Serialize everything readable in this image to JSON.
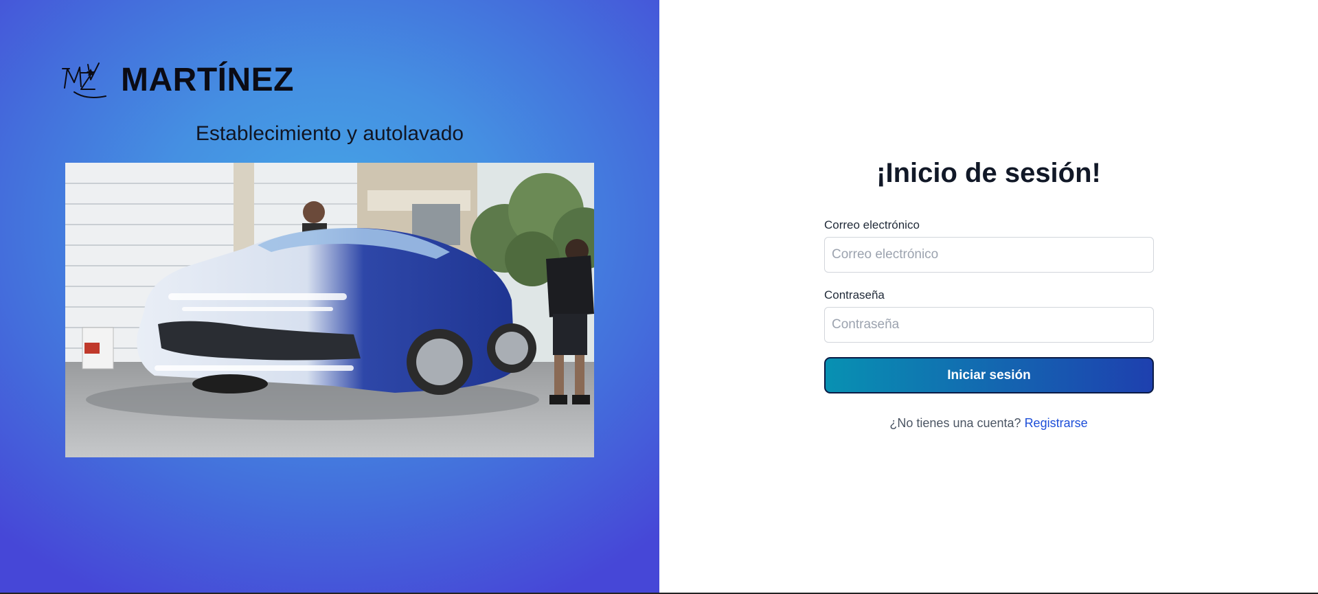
{
  "brand": {
    "name": "MARTÍNEZ",
    "tagline": "Establecimiento y autolavado"
  },
  "login": {
    "title": "¡Inicio de sesión!",
    "email": {
      "label": "Correo electrónico",
      "placeholder": "Correo electrónico",
      "value": ""
    },
    "password": {
      "label": "Contraseña",
      "placeholder": "Contraseña",
      "value": ""
    },
    "submit_label": "Iniciar sesión",
    "register_prompt": "¿No tienes una cuenta?",
    "register_link": "Registrarse"
  },
  "colors": {
    "left_panel_center": "#45a6e6",
    "left_panel_edge": "#4647d7",
    "button_start": "#0891b2",
    "button_end": "#1e40af",
    "link": "#1d4ed8"
  },
  "icons": {
    "logo": "mz-monogram-logo"
  }
}
